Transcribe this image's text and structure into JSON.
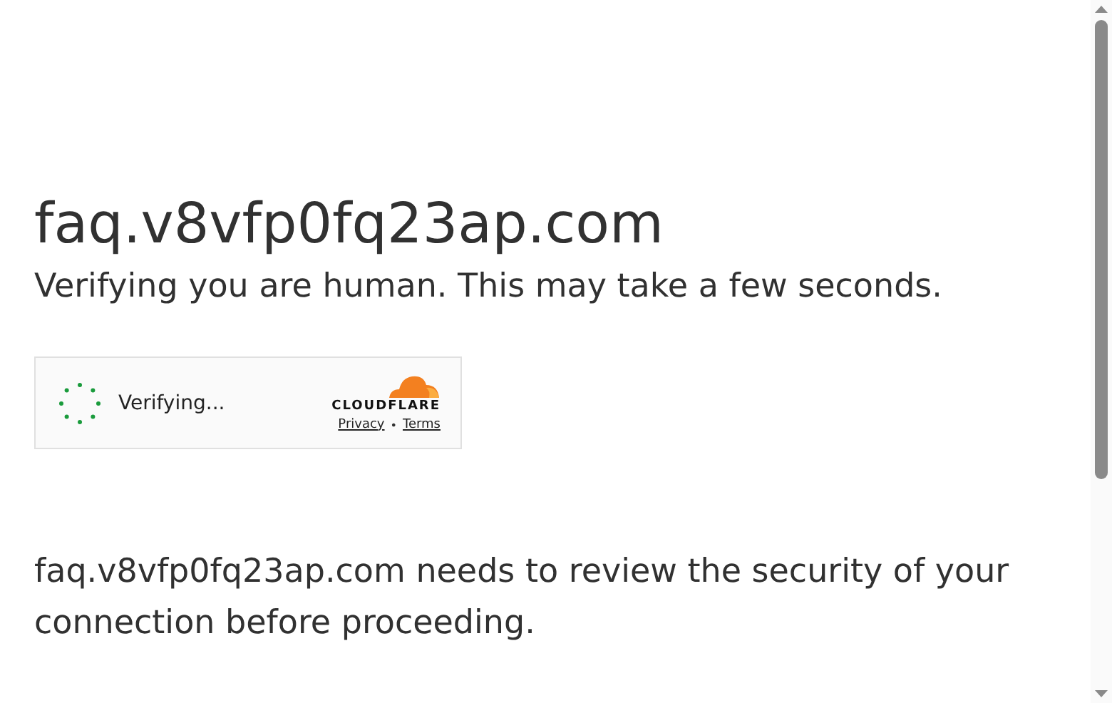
{
  "heading": "faq.v8vfp0fq23ap.com",
  "subheading": "Verifying you are human. This may take a few seconds.",
  "widget": {
    "status": "Verifying...",
    "logo_text": "CLOUDFLARE",
    "links": [
      {
        "label": "Privacy"
      },
      {
        "label": "Terms"
      }
    ],
    "separator": "•"
  },
  "message": "faq.v8vfp0fq23ap.com needs to review the security of your connection before proceeding."
}
